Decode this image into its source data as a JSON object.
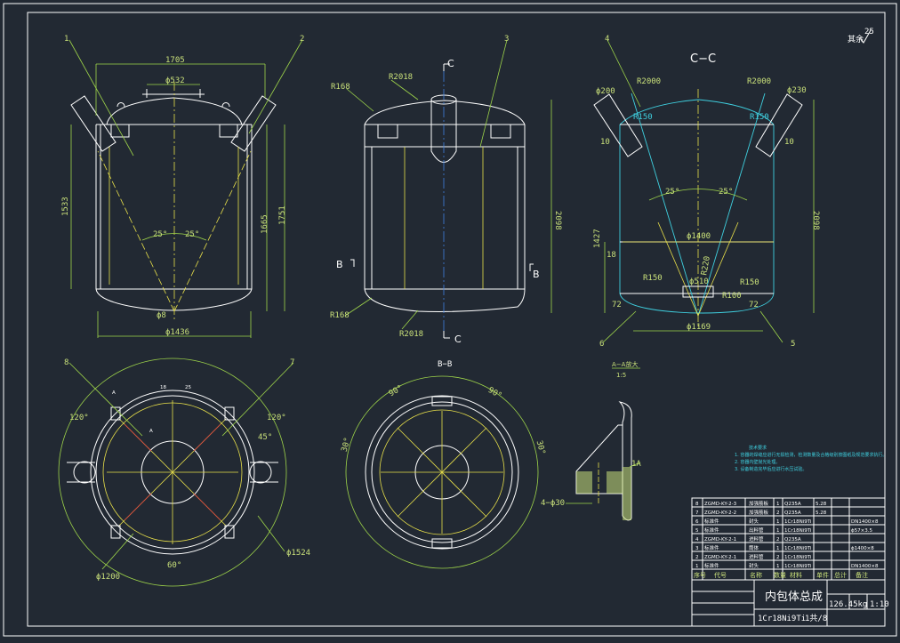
{
  "drawing": {
    "roughness_symbol": "25",
    "roughness_prefix": "其余",
    "view1": {
      "leaders": [
        "1",
        "2"
      ],
      "dims": [
        "1705",
        "ϕ532",
        "1533",
        "1665",
        "1751",
        "25°",
        "25°",
        "ϕ1436",
        "ϕ8"
      ]
    },
    "view2": {
      "leaders": [
        "3"
      ],
      "section_marks": [
        "C",
        "C",
        "B",
        "B"
      ],
      "dims": [
        "R168",
        "R2018",
        "R168",
        "R2018",
        "2098"
      ]
    },
    "view3": {
      "title": "C−C",
      "leaders": [
        "4",
        "5",
        "6"
      ],
      "dims": [
        "ϕ200",
        "R2000",
        "R2000",
        "ϕ230",
        "R150",
        "R150",
        "10",
        "10",
        "25°",
        "25°",
        "1427",
        "18",
        "ϕ1400",
        "2098",
        "R150",
        "R150",
        "ϕ510",
        "ϕ1169",
        "72",
        "72",
        "R220",
        "R100"
      ]
    },
    "view4": {
      "leaders": [
        "8",
        "7"
      ],
      "dims": [
        "18",
        "25",
        "120°",
        "120°",
        "45°",
        "ϕ1524",
        "ϕ1200",
        "60°",
        "A",
        "A"
      ]
    },
    "view5": {
      "title": "B−B",
      "dims": [
        "90°",
        "90°",
        "30°",
        "30°"
      ]
    },
    "detail": {
      "title": "A−A放大",
      "scale": "1:5",
      "dims": [
        "4−ϕ30",
        "1A"
      ]
    },
    "notes": {
      "title": "技术要求",
      "lines": [
        "1. 容器的焊缝应进行无损检测，检测数量及合格级别按图纸及规范要求执行。",
        "2. 容器内壁抛光处理。",
        "3. 设备制造完毕后应进行水压试验。"
      ]
    },
    "title_block": {
      "rows": [
        {
          "no": "8",
          "code": "ZGMD-KY-2-3",
          "name": "加强筋板",
          "qty": "1",
          "material": "Q235A",
          "weight": "5.28",
          "note": ""
        },
        {
          "no": "7",
          "code": "ZGMD-KY-2-2",
          "name": "加强筋板",
          "qty": "2",
          "material": "Q235A",
          "weight": "5.28",
          "note": ""
        },
        {
          "no": "6",
          "code": "标准件",
          "name": "封头",
          "qty": "1",
          "material": "1Cr18Ni9Ti",
          "weight": "",
          "note": "DN1400×8"
        },
        {
          "no": "5",
          "code": "标准件",
          "name": "出料管",
          "qty": "1",
          "material": "1Cr18Ni9Ti",
          "weight": "",
          "note": "ϕ57×3.5"
        },
        {
          "no": "4",
          "code": "ZGMD-KY-2-1",
          "name": "进料管",
          "qty": "2",
          "material": "Q235A",
          "weight": "",
          "note": ""
        },
        {
          "no": "3",
          "code": "标准件",
          "name": "筒体",
          "qty": "1",
          "material": "1Cr18Ni9Ti",
          "weight": "",
          "note": "ϕ1400×8"
        },
        {
          "no": "2",
          "code": "ZGMD-KY-2-1",
          "name": "进料管",
          "qty": "2",
          "material": "1Cr18Ni9Ti",
          "weight": "",
          "note": ""
        },
        {
          "no": "1",
          "code": "标准件",
          "name": "封头",
          "qty": "1",
          "material": "1Cr18Ni9Ti",
          "weight": "",
          "note": "DN1400×8"
        }
      ],
      "headers": [
        "序号",
        "代号",
        "名称",
        "数量",
        "材料",
        "单件",
        "总计",
        "备注"
      ],
      "drawing_title": "内包体总成",
      "material": "1Cr18Ni9Ti",
      "sheet": "1共/8",
      "scale": "1:10",
      "weight": "126.45kg"
    }
  }
}
